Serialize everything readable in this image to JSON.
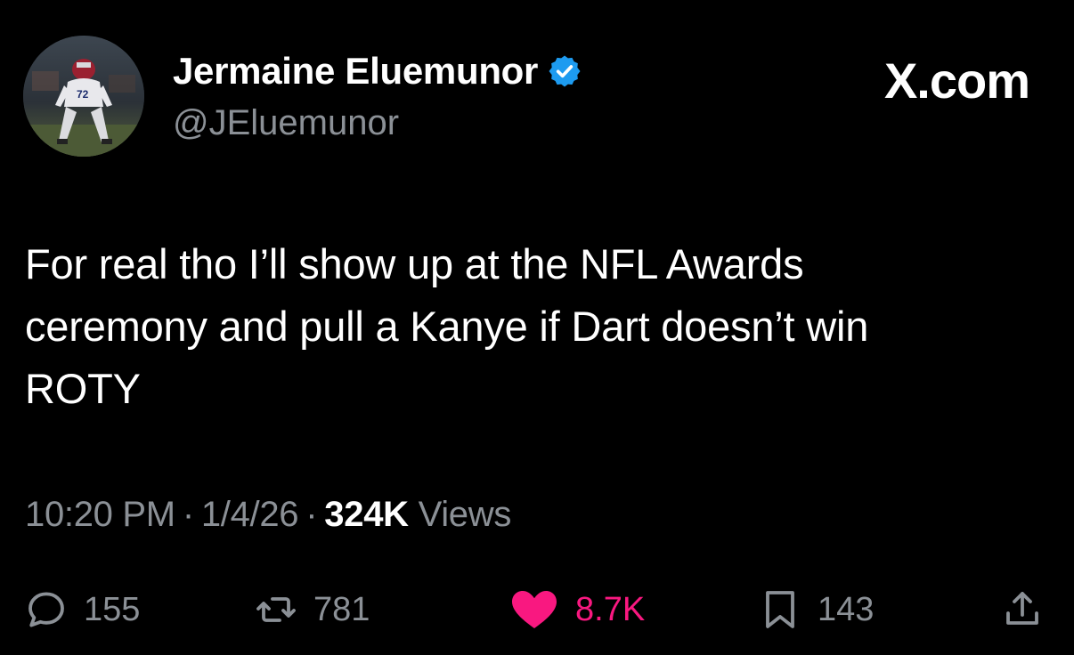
{
  "author": {
    "display_name": "Jermaine Eluemunor",
    "handle": "@JEluemunor",
    "verified": true,
    "avatar_icon": "profile-photo"
  },
  "source": {
    "label": "X.com"
  },
  "tweet": {
    "text": "For real tho I’ll show up at the NFL Awards\nceremony and pull a Kanye if Dart doesn’t win\nROTY",
    "time": "10:20 PM",
    "date": "1/4/26",
    "views_count": "324K",
    "views_label": "Views",
    "separator": "·"
  },
  "actions": {
    "replies": {
      "icon": "reply-icon",
      "count": "155"
    },
    "reposts": {
      "icon": "repost-icon",
      "count": "781"
    },
    "likes": {
      "icon": "heart-icon",
      "count": "8.7K",
      "active": true
    },
    "bookmarks": {
      "icon": "bookmark-icon",
      "count": "143"
    },
    "share": {
      "icon": "share-icon"
    }
  },
  "colors": {
    "background": "#000000",
    "text_primary": "#ffffff",
    "text_secondary": "#8b9096",
    "verified_blue": "#1d9bf0",
    "like_pink": "#f91880"
  }
}
